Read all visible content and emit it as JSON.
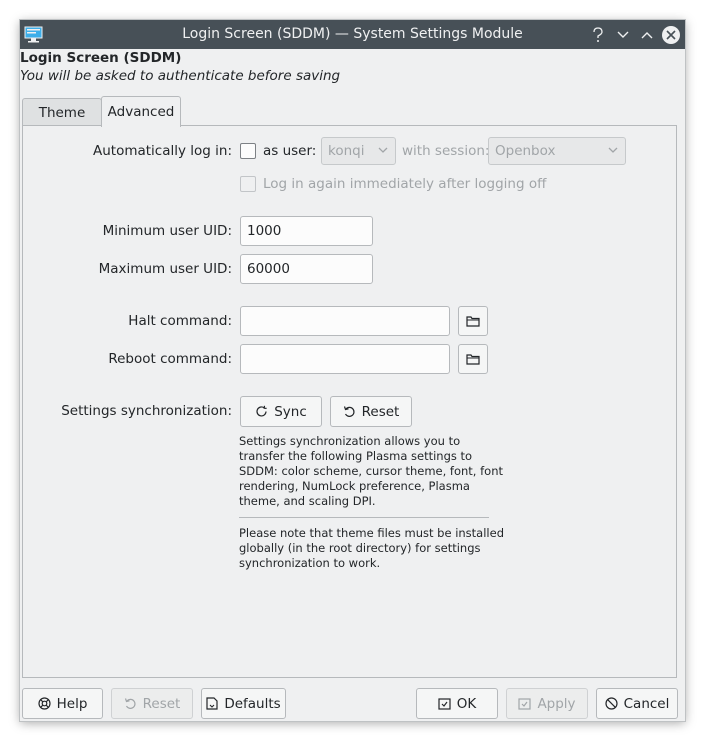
{
  "window": {
    "title": "Login Screen (SDDM) — System Settings Module",
    "title_buttons": [
      "help-icon",
      "minimize-icon",
      "maximize-icon",
      "close-icon"
    ]
  },
  "header": {
    "title": "Login Screen (SDDM)",
    "subtitle": "You will be asked to authenticate before saving"
  },
  "tabs": [
    {
      "label": "Theme",
      "active": false
    },
    {
      "label": "Advanced",
      "active": true
    }
  ],
  "advanced": {
    "autologin_label": "Automatically log in:",
    "as_user_label": "as user:",
    "autologin_checked": false,
    "user_value": "konqi",
    "with_session_label": "with session:",
    "session_value": "Openbox",
    "relogin_label": "Log in again immediately after logging off",
    "relogin_checked": false,
    "min_uid_label": "Minimum user UID:",
    "min_uid_value": "1000",
    "max_uid_label": "Maximum user UID:",
    "max_uid_value": "60000",
    "halt_label": "Halt command:",
    "halt_value": "",
    "reboot_label": "Reboot command:",
    "reboot_value": "",
    "sync_label": "Settings synchronization:",
    "sync_button": "Sync",
    "reset_button": "Reset",
    "sync_note_lines": [
      "Settings synchronization allows you to",
      "transfer the following Plasma settings to",
      "SDDM: color scheme, cursor theme, font, font",
      "rendering, NumLock preference, Plasma",
      "theme, and scaling DPI."
    ],
    "install_note_lines": [
      "Please note that theme files must be installed",
      "globally (in the root directory) for settings",
      "synchronization to work."
    ]
  },
  "footer": {
    "help": "Help",
    "reset": "Reset",
    "defaults": "Defaults",
    "ok": "OK",
    "apply": "Apply",
    "cancel": "Cancel"
  },
  "colors": {
    "titlebar": "#475057",
    "window_bg": "#eff0f1",
    "text": "#232629",
    "disabled_text": "#a1a5a8"
  }
}
